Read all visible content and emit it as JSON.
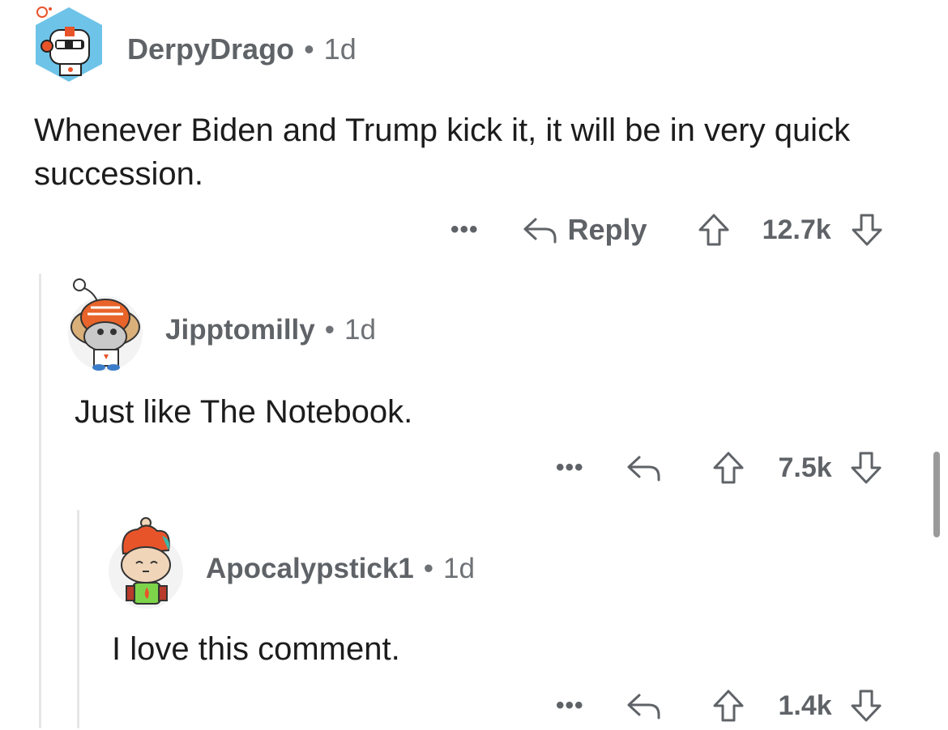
{
  "comments": [
    {
      "username": "DerpyDrago",
      "age": "1d",
      "body": "Whenever Biden and Trump kick it, it will be in very quick succession.",
      "more_label": "•••",
      "reply_label": "Reply",
      "score": "12.7k"
    },
    {
      "username": "Jipptomilly",
      "age": "1d",
      "body": "Just like The Notebook.",
      "more_label": "•••",
      "score": "7.5k"
    },
    {
      "username": "Apocalypstick1",
      "age": "1d",
      "body": "I love this comment.",
      "more_label": "•••",
      "score": "1.4k"
    }
  ],
  "separator": "•",
  "icons": {
    "reply": "reply-arrow-icon",
    "upvote": "upvote-arrow-icon",
    "downvote": "downvote-arrow-icon",
    "more": "more-dots-icon"
  },
  "colors": {
    "text_primary": "#1c1c1c",
    "text_meta": "#5f6367",
    "thread_line": "#e6e6e6"
  }
}
